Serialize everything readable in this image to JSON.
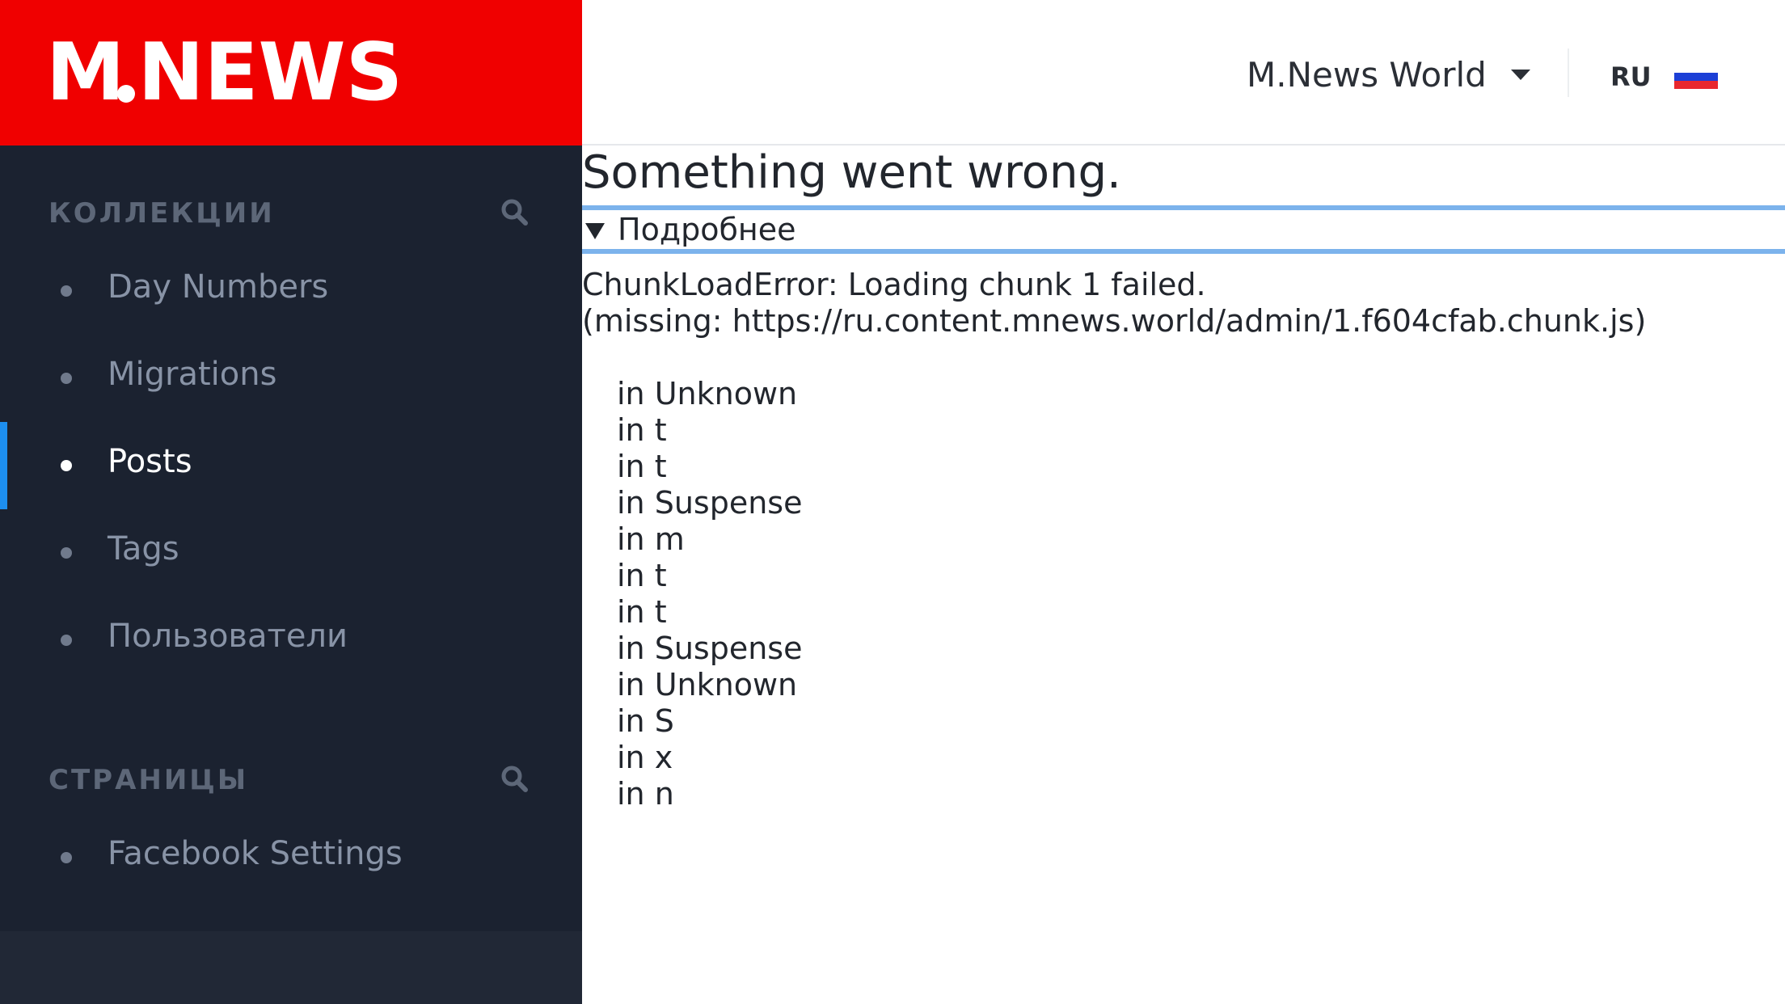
{
  "brand": {
    "logo_text_left": "M",
    "logo_text_right": "NEWS",
    "color": "#f00000"
  },
  "sidebar": {
    "collections_title": "КОЛЛЕКЦИИ",
    "collections": [
      {
        "label": "Day Numbers",
        "active": false
      },
      {
        "label": "Migrations",
        "active": false
      },
      {
        "label": "Posts",
        "active": true
      },
      {
        "label": "Tags",
        "active": false
      },
      {
        "label": "Пользователи",
        "active": false
      }
    ],
    "pages_title": "СТРАНИЦЫ",
    "pages": [
      {
        "label": "Facebook Settings",
        "active": false
      }
    ],
    "search_icon": "search-icon",
    "background": "#1b2230",
    "accent": "#1d8ff0"
  },
  "topbar": {
    "site_name": "M.News World",
    "dropdown_icon": "chevron-down-icon",
    "language_code": "RU",
    "flag_icon": "russia-flag-icon",
    "flag_colors": [
      "#ffffff",
      "#1c3fd6",
      "#e8282e"
    ]
  },
  "error": {
    "title": "Something went wrong.",
    "details_label": "Подробнее",
    "message_lines": [
      "ChunkLoadError: Loading chunk 1 failed.",
      "(missing: https://ru.content.mnews.world/admin/1.f604cfab.chunk.js)"
    ],
    "stack": [
      "in Unknown",
      "in t",
      "in t",
      "in Suspense",
      "in m",
      "in t",
      "in t",
      "in Suspense",
      "in Unknown",
      "in S",
      "in x",
      "in n"
    ],
    "details_border_color": "#7cb3ec"
  }
}
